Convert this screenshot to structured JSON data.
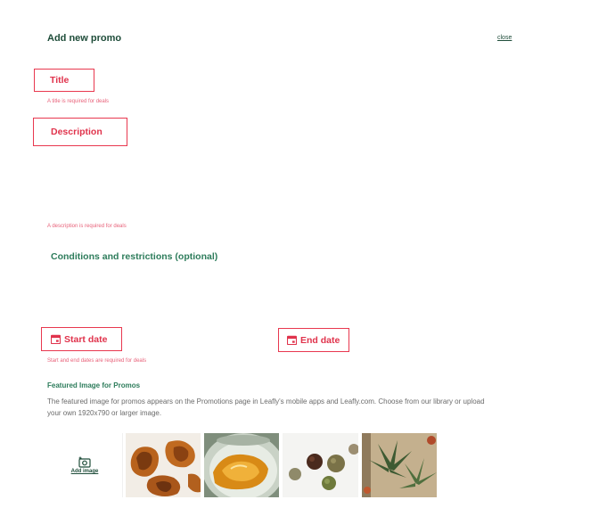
{
  "header": {
    "title": "Add new promo",
    "close_label": "close"
  },
  "title_field": {
    "label": "Title",
    "error": "A title is required for deals"
  },
  "description_field": {
    "label": "Description",
    "error": "A description is required for deals"
  },
  "conditions_field": {
    "label": "Conditions and restrictions (optional)"
  },
  "dates": {
    "start_label": "Start date",
    "end_label": "End date",
    "error": "Start and end dates are required for deals"
  },
  "featured": {
    "title": "Featured Image for Promos",
    "description_line1": "The featured image for promos appears on the Promotions page in Leafly's mobile apps and Leafly.com. Choose from our library or upload",
    "description_line2": "your own 1920x790 or larger image.",
    "add_image_label": "Add image"
  },
  "colors": {
    "error_red": "#e8384f",
    "brand_green": "#2d7c5b",
    "dark_green": "#1f4d3a"
  },
  "icons": [
    "calendar-icon",
    "add-image-icon"
  ]
}
